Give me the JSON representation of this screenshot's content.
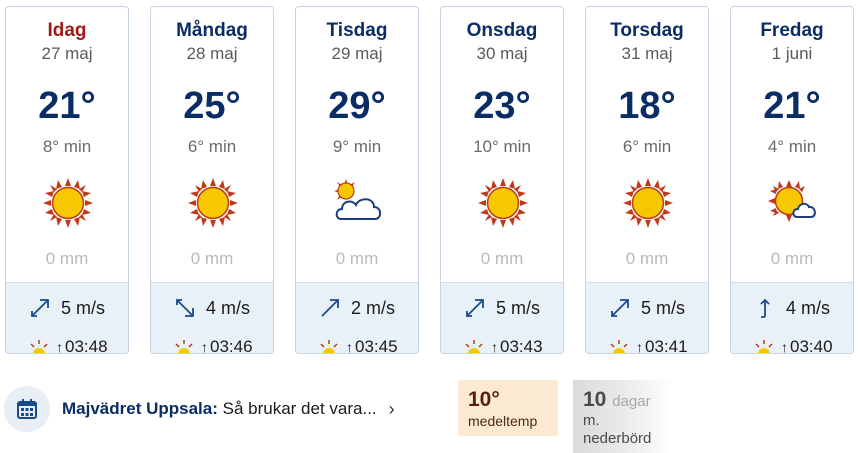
{
  "days": [
    {
      "name": "Idag",
      "date": "27 maj",
      "max": "21°",
      "min": "8° min",
      "icon": "sun-icon",
      "precip": "0 mm",
      "wind_speed": "5 m/s",
      "wind_icon": "wind-arrow-northeast-icon",
      "sunrise": "03:48"
    },
    {
      "name": "Måndag",
      "date": "28 maj",
      "max": "25°",
      "min": "6° min",
      "icon": "sun-icon",
      "precip": "0 mm",
      "wind_speed": "4 m/s",
      "wind_icon": "wind-arrow-southeast-icon",
      "sunrise": "03:46"
    },
    {
      "name": "Tisdag",
      "date": "29 maj",
      "max": "29°",
      "min": "9° min",
      "icon": "partly-cloudy-icon",
      "precip": "0 mm",
      "wind_speed": "2 m/s",
      "wind_icon": "wind-arrow-northeast-icon",
      "sunrise": "03:45"
    },
    {
      "name": "Onsdag",
      "date": "30 maj",
      "max": "23°",
      "min": "10° min",
      "icon": "sun-icon",
      "precip": "0 mm",
      "wind_speed": "5 m/s",
      "wind_icon": "wind-arrow-northeast-icon",
      "sunrise": "03:43"
    },
    {
      "name": "Torsdag",
      "date": "31 maj",
      "max": "18°",
      "min": "6° min",
      "icon": "sun-icon",
      "precip": "0 mm",
      "wind_speed": "5 m/s",
      "wind_icon": "wind-arrow-northeast-icon",
      "sunrise": "03:41"
    },
    {
      "name": "Fredag",
      "date": "1 juni",
      "max": "21°",
      "min": "4° min",
      "icon": "sun-small-cloud-icon",
      "precip": "0 mm",
      "wind_speed": "4 m/s",
      "wind_icon": "wind-arrow-north-icon",
      "sunrise": "03:40"
    }
  ],
  "promo": {
    "title": "Majvädret Uppsala:",
    "text": "Så brukar det vara...",
    "chevron": "›",
    "icon": "calendar-icon"
  },
  "stats": {
    "temp_value": "10°",
    "temp_label": "medeltemp",
    "rain_value": "10",
    "rain_unit": "dagar",
    "rain_label_line1": "m.",
    "rain_label_line2": "nederbörd"
  },
  "colors": {
    "today": "#a01a1a",
    "navy": "#0b2d66",
    "sun_fill": "#f7c800",
    "sun_rays": "#c0391b",
    "card_bottom": "#e8f0f8",
    "temp_box": "#fbe9d2"
  }
}
